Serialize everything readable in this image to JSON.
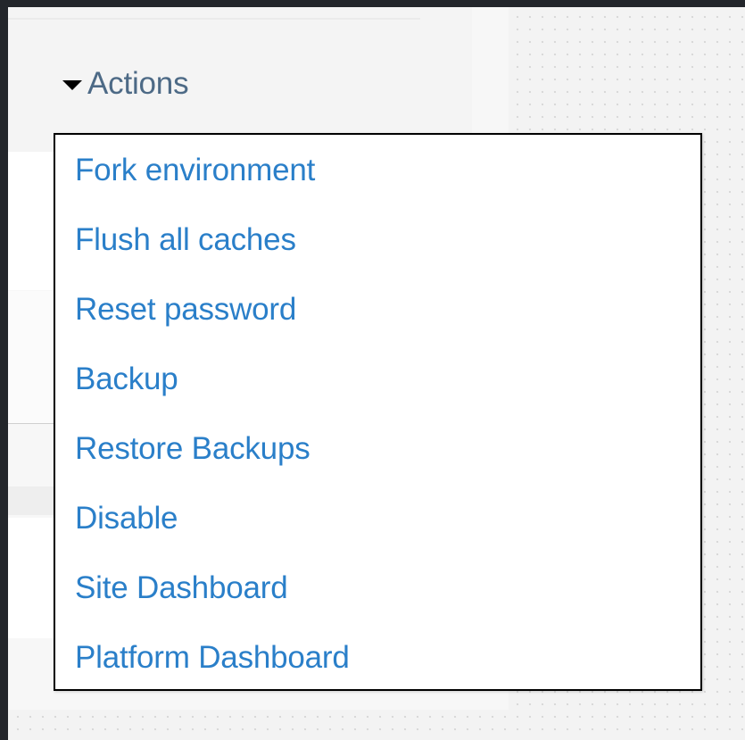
{
  "actions_menu": {
    "toggle_label": "Actions",
    "toggle_icon": "caret-down-icon",
    "link_color": "#2a7fc9",
    "toggle_color": "#4d6a86",
    "items": [
      {
        "label": "Fork environment"
      },
      {
        "label": "Flush all caches"
      },
      {
        "label": "Reset password"
      },
      {
        "label": "Backup"
      },
      {
        "label": "Restore Backups"
      },
      {
        "label": "Disable"
      },
      {
        "label": "Site Dashboard"
      },
      {
        "label": "Platform Dashboard"
      }
    ]
  }
}
